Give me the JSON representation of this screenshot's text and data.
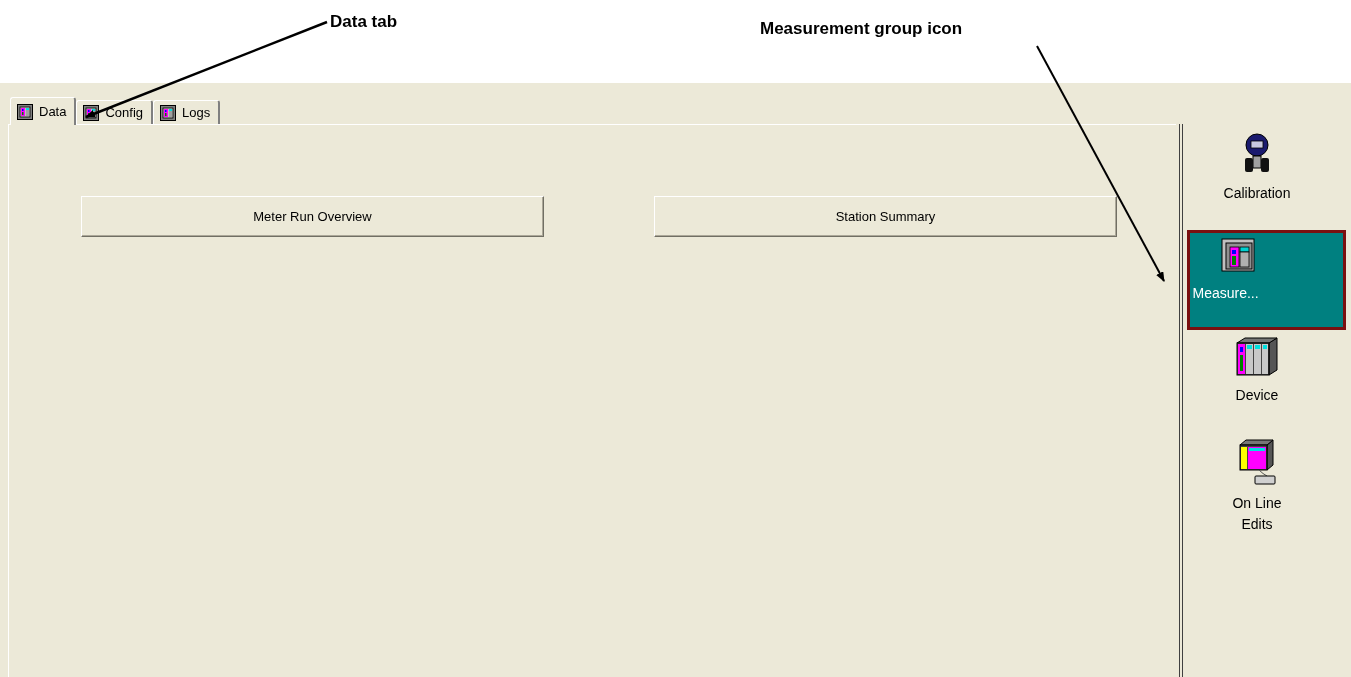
{
  "annotations": [
    {
      "text": "Data tab"
    },
    {
      "text": "Measurement group icon"
    }
  ],
  "tabs": [
    {
      "label": "Data",
      "selected": true
    },
    {
      "label": "Config",
      "selected": false
    },
    {
      "label": "Logs",
      "selected": false
    }
  ],
  "buttons": [
    "Meter Run Overview",
    "Station Summary"
  ],
  "sidebar": {
    "items": [
      {
        "kind": "calibration",
        "label": "Calibration",
        "selected": false
      },
      {
        "kind": "measurement",
        "label": "Measure...",
        "selected": true
      },
      {
        "kind": "device",
        "label": "Device",
        "selected": false
      },
      {
        "kind": "online",
        "label": "On Line Edits",
        "selected": false
      }
    ]
  }
}
